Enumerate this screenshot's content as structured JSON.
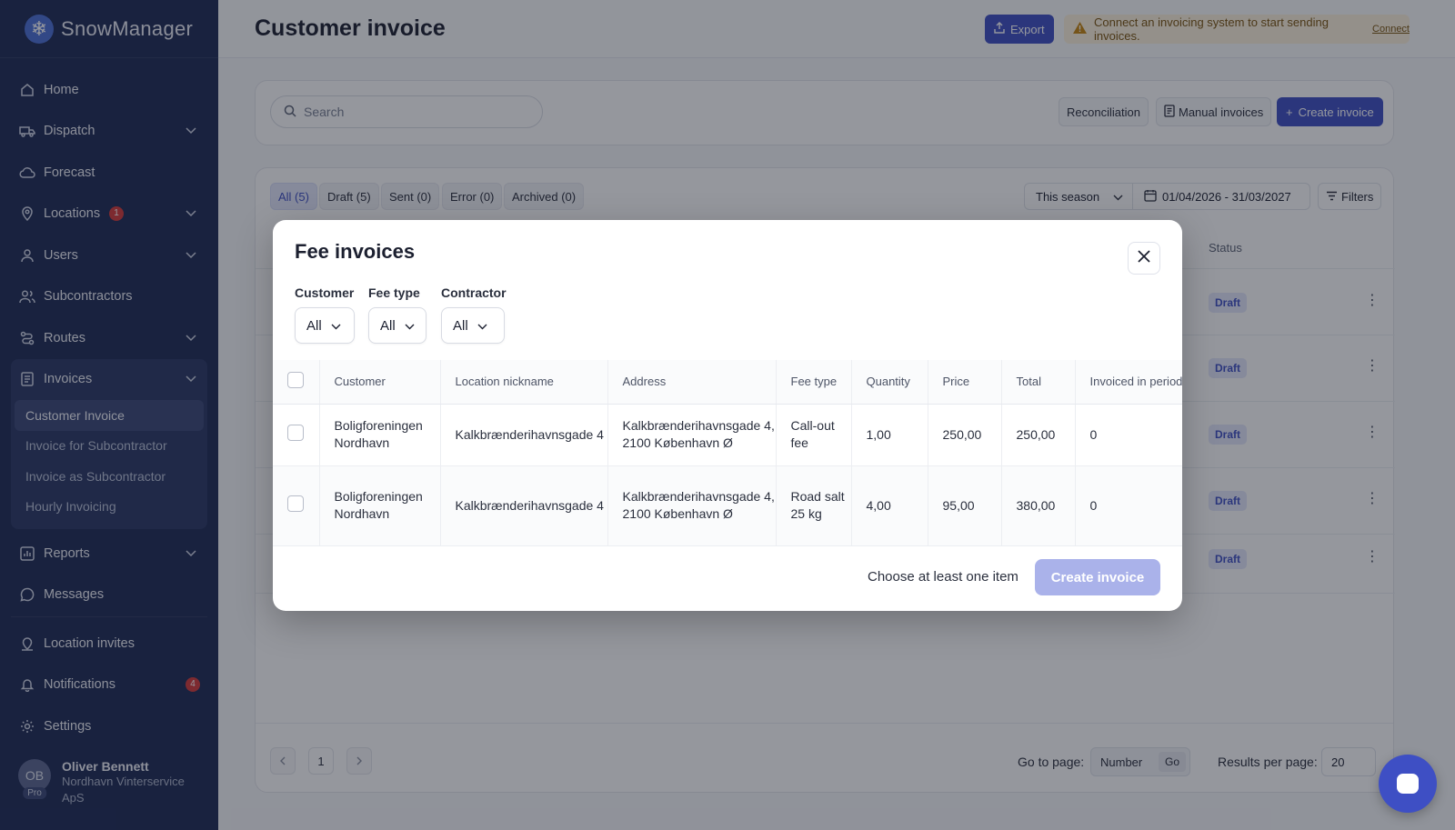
{
  "brand": {
    "name": "SnowManager",
    "logo_icon": "snowflake-icon"
  },
  "sidebar": {
    "items": [
      {
        "label": "Home",
        "icon": "home-icon"
      },
      {
        "label": "Dispatch",
        "icon": "truck-icon",
        "expandable": true
      },
      {
        "label": "Forecast",
        "icon": "cloud-icon"
      },
      {
        "label": "Locations",
        "icon": "pin-icon",
        "expandable": true,
        "badge": "1"
      },
      {
        "label": "Users",
        "icon": "user-icon",
        "expandable": true
      },
      {
        "label": "Subcontractors",
        "icon": "users-icon"
      },
      {
        "label": "Routes",
        "icon": "route-icon",
        "expandable": true
      }
    ],
    "invoices": {
      "label": "Invoices",
      "sub_items": [
        "Customer Invoice",
        "Invoice for Subcontractor",
        "Invoice as Subcontractor",
        "Hourly Invoicing"
      ],
      "active": "Customer Invoice"
    },
    "after_items": [
      {
        "label": "Reports",
        "icon": "chart-icon",
        "expandable": true
      },
      {
        "label": "Messages",
        "icon": "message-icon"
      }
    ],
    "bottom_items": [
      {
        "label": "Location invites",
        "icon": "invite-icon"
      },
      {
        "label": "Notifications",
        "icon": "bell-icon",
        "count": "4"
      },
      {
        "label": "Settings",
        "icon": "gear-icon"
      }
    ],
    "user": {
      "initials": "OB",
      "plan": "Pro",
      "name": "Oliver Bennett",
      "org": "Nordhavn Vinterservice ApS"
    }
  },
  "header": {
    "title": "Customer invoice",
    "export_label": "Export",
    "warning_text": "Connect an invoicing system to start sending invoices.",
    "warning_link": "Connect"
  },
  "toolbar": {
    "search_placeholder": "Search",
    "reconciliation_label": "Reconciliation",
    "manual_invoices_label": "Manual invoices",
    "create_invoice_label": "Create invoice"
  },
  "tabs": [
    "All (5)",
    "Draft (5)",
    "Sent (0)",
    "Error (0)",
    "Archived (0)"
  ],
  "period": {
    "season": "This season",
    "range": "01/04/2026 - 31/03/2027",
    "filters_label": "Filters"
  },
  "table_bg": {
    "status_header": "Status",
    "status_value": "Draft"
  },
  "pagination": {
    "page": "1",
    "goto_label": "Go to page:",
    "number_placeholder": "Number",
    "go_label": "Go",
    "per_page_label": "Results per page:",
    "per_page_value": "20"
  },
  "modal": {
    "title": "Fee invoices",
    "filters": [
      {
        "label": "Customer",
        "value": "All"
      },
      {
        "label": "Fee type",
        "value": "All"
      },
      {
        "label": "Contractor",
        "value": "All"
      }
    ],
    "columns": [
      "Customer",
      "Location nickname",
      "Address",
      "Fee type",
      "Quantity",
      "Price",
      "Total",
      "Invoiced in period"
    ],
    "rows": [
      [
        "Boligforeningen Nordhavn",
        "Kalkbrænderihavnsgade 4",
        "Kalkbrænderihavnsgade 4, 2100 København Ø",
        "Call-out fee",
        "1,00",
        "250,00",
        "250,00",
        "0"
      ],
      [
        "Boligforeningen Nordhavn",
        "Kalkbrænderihavnsgade 4",
        "Kalkbrænderihavnsgade 4, 2100 København Ø",
        "Road salt 25 kg",
        "4,00",
        "95,00",
        "380,00",
        "0"
      ]
    ],
    "hint": "Choose at least one item",
    "create_label": "Create invoice"
  },
  "colors": {
    "sidebar": "#1e2a55",
    "accent": "#3e4fc4",
    "accent_disabled": "#aab2ea",
    "badge": "#d33a3a"
  }
}
